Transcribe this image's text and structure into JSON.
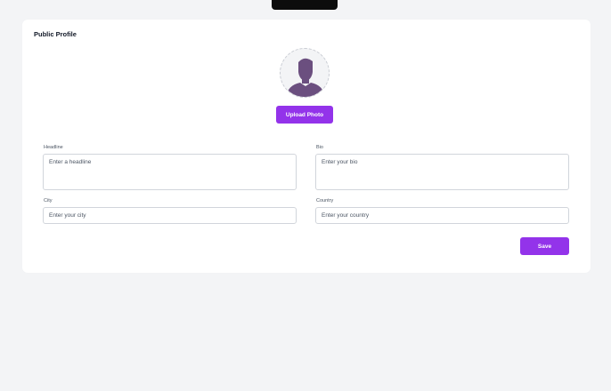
{
  "profile": {
    "title": "Public Profile",
    "upload_label": "Upload Photo",
    "save_label": "Save",
    "fields": {
      "headline": {
        "label": "Headline",
        "placeholder": "Enter a headline"
      },
      "bio": {
        "label": "Bio",
        "placeholder": "Enter your bio"
      },
      "city": {
        "label": "City",
        "placeholder": "Enter your city"
      },
      "country": {
        "label": "Country",
        "placeholder": "Enter your country"
      }
    }
  },
  "icons": {
    "avatar": "user-silhouette-icon"
  },
  "colors": {
    "accent": "#9333ea",
    "avatar_silhouette": "#6b4f7f",
    "page_background": "#f3f4f6",
    "card_background": "#ffffff"
  }
}
